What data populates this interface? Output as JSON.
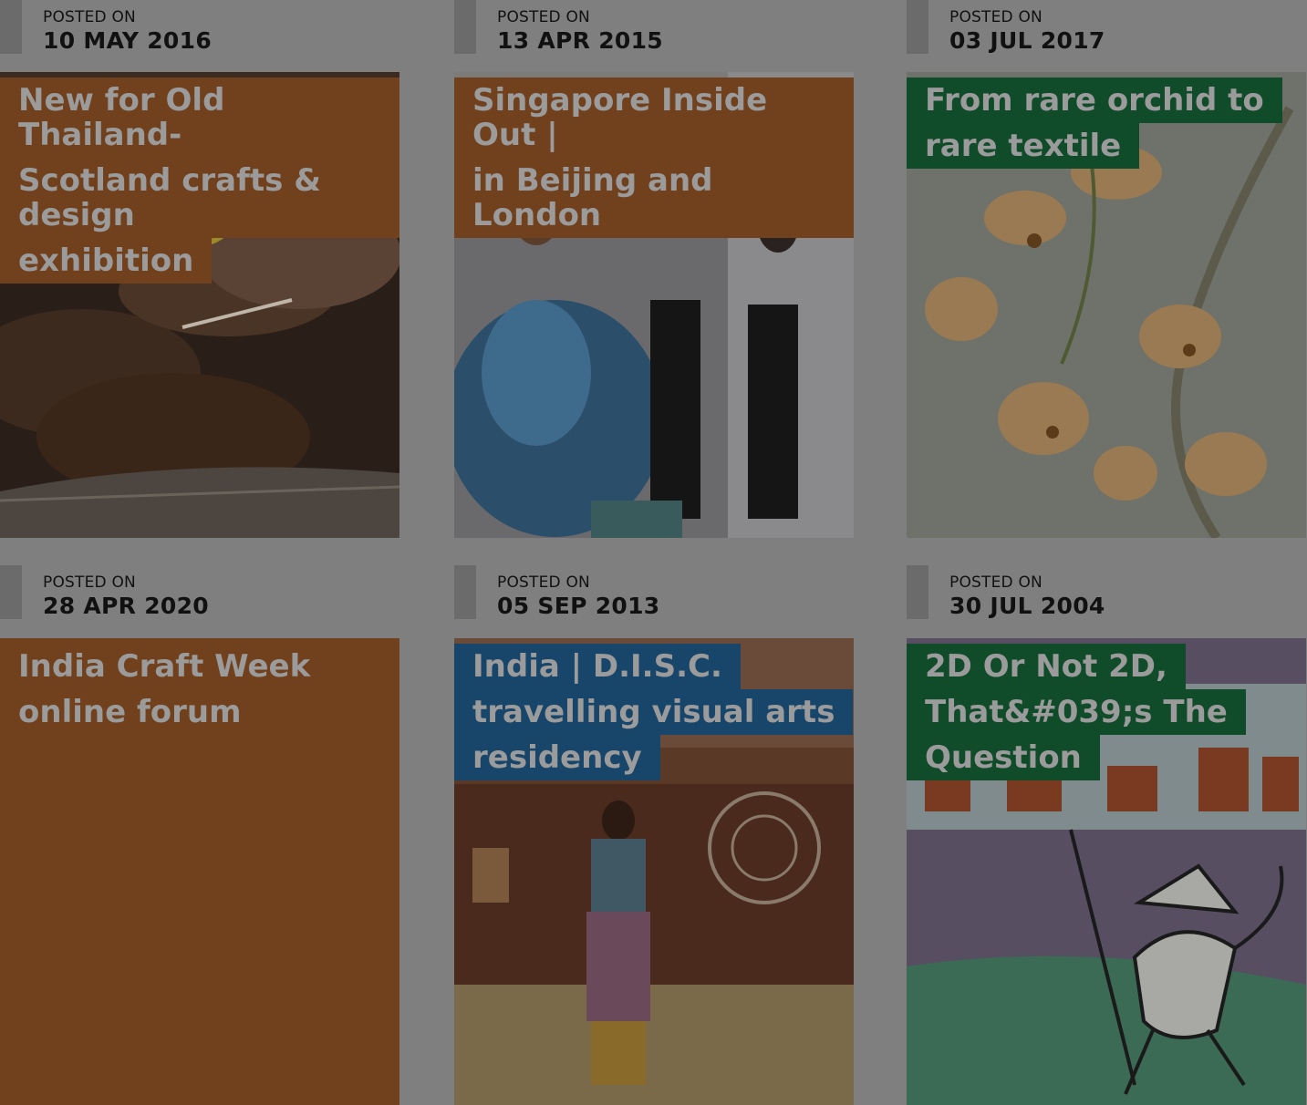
{
  "posted_label": "POSTED ON",
  "colors": {
    "brown": "#71401d",
    "green": "#104b2a",
    "blue": "#17466a",
    "page_bg": "#7f7f7f",
    "date_bar": "#6b6b6b"
  },
  "posts": [
    {
      "date": "10 MAY 2016",
      "title_lines": [
        "New for Old Thailand-",
        "Scotland crafts & design",
        "exhibition"
      ],
      "label_color": "brown",
      "image": "hands-weaving-thread-photo"
    },
    {
      "date": "13 APR 2015",
      "title_lines": [
        "Singapore Inside Out |",
        "in Beijing and London"
      ],
      "label_color": "brown",
      "image": "exhibition-crowd-photo"
    },
    {
      "date": "03 JUL 2017",
      "title_lines": [
        "From rare orchid to",
        "rare textile"
      ],
      "label_color": "green",
      "image": "orange-orchid-photo"
    },
    {
      "date": "28 APR 2020",
      "title_lines": [
        "India Craft Week",
        "online forum"
      ],
      "label_color": "brown",
      "image": "none"
    },
    {
      "date": "05 SEP 2013",
      "title_lines": [
        "India | D.I.S.C.",
        "travelling visual arts",
        "residency"
      ],
      "label_color": "blue",
      "image": "woman-in-village-photo"
    },
    {
      "date": "30 JUL 2004",
      "title_lines": [
        "2D Or Not 2D,",
        "That&#039;s The",
        "Question"
      ],
      "label_color": "green",
      "image": "stick-figure-painting"
    }
  ]
}
